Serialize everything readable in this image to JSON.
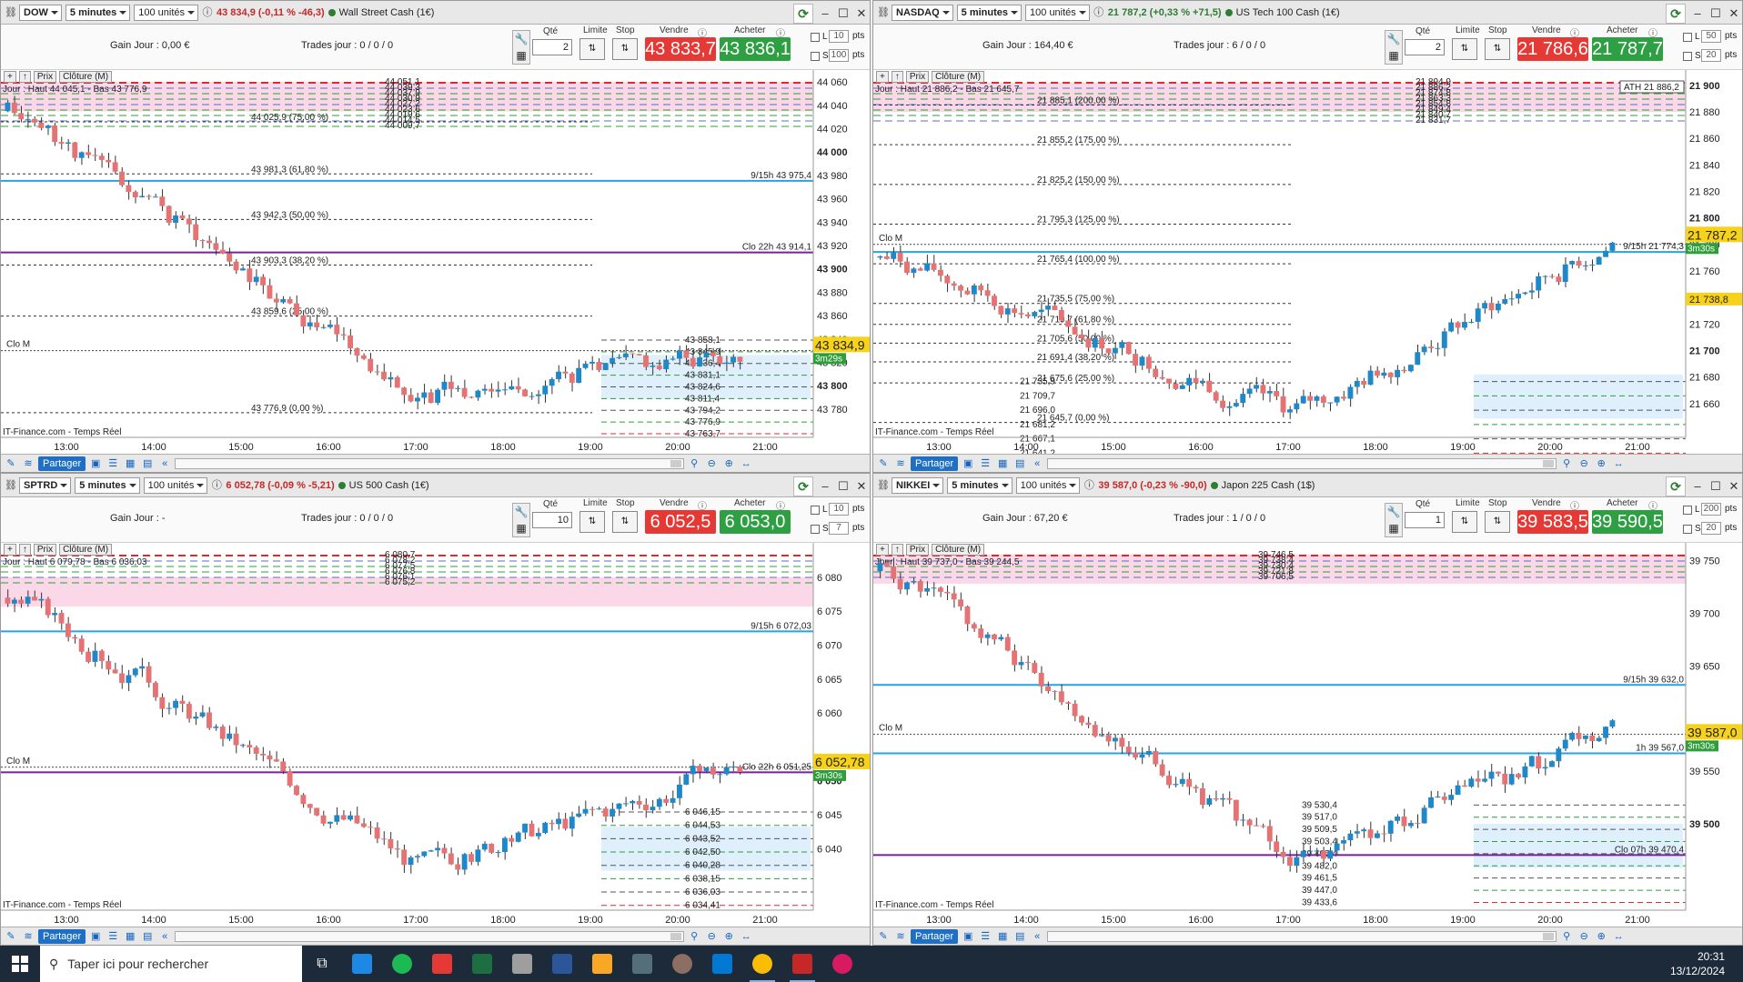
{
  "panes": [
    {
      "symbol": "DOW",
      "timeframe": "5 minutes",
      "units": "100 unités",
      "quote": "43 834,9 (-0,11 % -46,3)",
      "quote_class": "neg",
      "name": "Wall Street Cash (1€)",
      "gain": "Gain Jour : 0,00 €",
      "trades": "Trades jour : 0 / 0 / 0",
      "qty": "2",
      "sell": "43 833,7",
      "buy": "43 836,1",
      "pts1": "10",
      "pts2": "100",
      "chart": {
        "ymin": 43762,
        "ymax": 44064,
        "ticks": [
          {
            "v": 44060,
            "label": "44 060",
            "bold": false
          },
          {
            "v": 44040,
            "label": "44 040",
            "bold": false
          },
          {
            "v": 44020,
            "label": "44 020",
            "bold": false
          },
          {
            "v": 44000,
            "label": "44 000",
            "bold": true
          },
          {
            "v": 43980,
            "label": "43 980",
            "bold": false
          },
          {
            "v": 43960,
            "label": "43 960",
            "bold": false
          },
          {
            "v": 43940,
            "label": "43 940",
            "bold": false
          },
          {
            "v": 43920,
            "label": "43 920",
            "bold": false
          },
          {
            "v": 43900,
            "label": "43 900",
            "bold": true
          },
          {
            "v": 43880,
            "label": "43 880",
            "bold": false
          },
          {
            "v": 43860,
            "label": "43 860",
            "bold": false
          },
          {
            "v": 43840,
            "label": "43 840",
            "bold": false
          },
          {
            "v": 43820,
            "label": "43 820",
            "bold": false
          },
          {
            "v": 43800,
            "label": "43 800",
            "bold": true
          },
          {
            "v": 43780,
            "label": "43 780",
            "bold": false
          }
        ],
        "xlabels": [
          "13:00",
          "14:00",
          "15:00",
          "16:00",
          "17:00",
          "18:00",
          "19:00",
          "20:00",
          "21:00"
        ],
        "price_label": "43 834,9",
        "price_value": 43834.9,
        "timer": "3m29s",
        "day_label": "Jour : Haut 44 045,1 - Bas 43 776,9",
        "fibs": [
          {
            "v": 44025.9,
            "label": "44 025,9 (75,00 %)"
          },
          {
            "v": 43981.3,
            "label": "43 981,3 (61,80 %)"
          },
          {
            "v": 43942.3,
            "label": "43 942,3 (50,00 %)"
          },
          {
            "v": 43903.3,
            "label": "43 903,3 (38,20 %)"
          },
          {
            "v": 43859.6,
            "label": "43 859,6 (25,00 %)"
          },
          {
            "v": 43776.9,
            "label": "43 776,9 (0,00 %)"
          }
        ],
        "levels_top": [
          "44 051,1",
          "44 039,3",
          "44 037,9",
          "44 030,9",
          "44 027,2",
          "44 023,6",
          "44 019,6",
          "44 014,5",
          "44 009,7"
        ],
        "levels_bottom": [
          "43 858,1",
          "43 845,9",
          "43 836,4",
          "43 831,1",
          "43 824,6",
          "43 811,4",
          "43 794,2",
          "43 776,9",
          "43 763,7"
        ],
        "line_blue": {
          "v": 43975.4,
          "label": "9/15h 43 975,4"
        },
        "line_purple": {
          "v": 43914.1,
          "label": "Clo 22h 43 914,1"
        },
        "clo_m": {
          "v": 43830,
          "label": "Clo M"
        },
        "candles_seed": 11,
        "start": 44035,
        "low": 43790,
        "end": 43834.9,
        "footer_src": "IT-Finance.com - Temps Réel"
      }
    },
    {
      "symbol": "NASDAQ",
      "timeframe": "5 minutes",
      "units": "100 unités",
      "quote": "21 787,2 (+0,33 % +71,5)",
      "quote_class": "pos",
      "name": "US Tech 100 Cash (1€)",
      "gain": "Gain Jour : 164,40 €",
      "trades": "Trades jour : 6 / 0 / 0",
      "qty": "2",
      "sell": "21 786,6",
      "buy": "21 787,7",
      "pts1": "50",
      "pts2": "20",
      "chart": {
        "ymin": 21640,
        "ymax": 21906,
        "ticks": [
          {
            "v": 21900,
            "label": "21 900",
            "bold": true
          },
          {
            "v": 21880,
            "label": "21 880",
            "bold": false
          },
          {
            "v": 21860,
            "label": "21 860",
            "bold": false
          },
          {
            "v": 21840,
            "label": "21 840",
            "bold": false
          },
          {
            "v": 21820,
            "label": "21 820",
            "bold": false
          },
          {
            "v": 21800,
            "label": "21 800",
            "bold": true
          },
          {
            "v": 21780,
            "label": "21 780",
            "bold": false
          },
          {
            "v": 21760,
            "label": "21 760",
            "bold": false
          },
          {
            "v": 21740,
            "label": "21 740",
            "bold": false
          },
          {
            "v": 21720,
            "label": "21 720",
            "bold": false
          },
          {
            "v": 21700,
            "label": "21 700",
            "bold": true
          },
          {
            "v": 21680,
            "label": "21 680",
            "bold": false
          },
          {
            "v": 21660,
            "label": "21 660",
            "bold": false
          }
        ],
        "xlabels": [
          "13:00",
          "14:00",
          "15:00",
          "16:00",
          "17:00",
          "18:00",
          "19:00",
          "20:00",
          "21:00"
        ],
        "price_label": "21 787,2",
        "price_value": 21787.2,
        "timer": "3m30s",
        "day_label": "Jour : Haut 21 886,2 - Bas 21 645,7",
        "fibs": [
          {
            "v": 21885.1,
            "label": "21 885,1 (200,00 %)"
          },
          {
            "v": 21855.2,
            "label": "21 855,2 (175,00 %)"
          },
          {
            "v": 21825.2,
            "label": "21 825,2 (150,00 %)"
          },
          {
            "v": 21795.3,
            "label": "21 795,3 (125,00 %)"
          },
          {
            "v": 21765.4,
            "label": "21 765,4 (100,00 %)"
          },
          {
            "v": 21735.5,
            "label": "21 735,5 (75,00 %)"
          },
          {
            "v": 21719.7,
            "label": "21 719,7 (61,80 %)"
          },
          {
            "v": 21705.6,
            "label": "21 705,6 (50,00 %)"
          },
          {
            "v": 21691.4,
            "label": "21 691,4 (38,20 %)"
          },
          {
            "v": 21675.6,
            "label": "21 675,6 (25,00 %)"
          },
          {
            "v": 21645.7,
            "label": "21 645,7 (0,00 %)"
          }
        ],
        "levels_top": [
          "21 894,9",
          "21 886,2",
          "21 874,8",
          "21 863,3",
          "21 854,8",
          "21 849,4",
          "21 840,7",
          "21 831,7"
        ],
        "levels_bottom": [
          "21 735,9",
          "21 709,7",
          "21 696,0",
          "21 681,2",
          "21 667,1",
          "21 641,2"
        ],
        "line_blue": {
          "v": 21774.3,
          "label": "9/15h 21 774,3"
        },
        "line_purple": null,
        "ath_label": "ATH 21 886,2",
        "right_tag": "21 738,8",
        "clo_m": {
          "v": 21780,
          "label": "Clo M"
        },
        "candles_seed": 7,
        "start": 21770,
        "low": 21650,
        "end": 21787.2,
        "footer_src": "IT-Finance.com - Temps Réel"
      }
    },
    {
      "symbol": "SPTRD",
      "timeframe": "5 minutes",
      "units": "100 unités",
      "quote": "6 052,78 (-0,09 % -5,21)",
      "quote_class": "neg",
      "name": "US 500 Cash (1€)",
      "gain": "Gain Jour : -",
      "trades": "Trades jour : 0 / 0 / 0",
      "qty": "10",
      "sell": "6 052,5",
      "buy": "6 053,0",
      "pts1": "10",
      "pts2": "7",
      "chart": {
        "ymin": 6032,
        "ymax": 6084,
        "ticks": [
          {
            "v": 6080,
            "label": "6 080",
            "bold": false
          },
          {
            "v": 6075,
            "label": "6 075",
            "bold": false
          },
          {
            "v": 6070,
            "label": "6 070",
            "bold": false
          },
          {
            "v": 6065,
            "label": "6 065",
            "bold": false
          },
          {
            "v": 6060,
            "label": "6 060",
            "bold": false
          },
          {
            "v": 6050,
            "label": "6 050",
            "bold": true
          },
          {
            "v": 6045,
            "label": "6 045",
            "bold": false
          },
          {
            "v": 6040,
            "label": "6 040",
            "bold": false
          }
        ],
        "xlabels": [
          "13:00",
          "14:00",
          "15:00",
          "16:00",
          "17:00",
          "18:00",
          "19:00",
          "20:00",
          "21:00"
        ],
        "price_label": "6 052,78",
        "price_value": 6052.78,
        "timer": "3m30s",
        "day_label": "Jour : Haut 6 079,78 - Bas 6 036,03",
        "fibs": [],
        "levels_top": [
          "6 080,7",
          "6 078,2",
          "6 077,5",
          "6 076,8",
          "6 076,1",
          "6 075,2"
        ],
        "levels_bottom": [
          "6 046,15",
          "6 044,53",
          "6 043,52",
          "6 042,50",
          "6 040,28",
          "6 038,15",
          "6 036,03",
          "6 034,41"
        ],
        "line_blue": {
          "v": 6072.03,
          "label": "9/15h 6 072,03"
        },
        "line_purple": {
          "v": 6051.25,
          "label": "Clo 22h 6 051,25"
        },
        "clo_m": {
          "v": 6052,
          "label": "Clo M"
        },
        "candles_seed": 3,
        "start": 6077,
        "low": 6037,
        "end": 6052.78,
        "footer_src": "IT-Finance.com - Temps Réel"
      }
    },
    {
      "symbol": "NIKKEI",
      "timeframe": "5 minutes",
      "units": "100 unités",
      "quote": "39 587,0 (-0,23 % -90,0)",
      "quote_class": "neg",
      "name": "Japon 225 Cash (1$)",
      "gain": "Gain Jour : 67,20 €",
      "trades": "Trades jour : 1 / 0 / 0",
      "qty": "1",
      "sell": "39 583,5",
      "buy": "39 590,5",
      "pts1": "200",
      "pts2": "20",
      "chart": {
        "ymin": 39425,
        "ymax": 39760,
        "ticks": [
          {
            "v": 39750,
            "label": "39 750",
            "bold": false
          },
          {
            "v": 39700,
            "label": "39 700",
            "bold": false
          },
          {
            "v": 39650,
            "label": "39 650",
            "bold": false
          },
          {
            "v": 39550,
            "label": "39 550",
            "bold": false
          },
          {
            "v": 39500,
            "label": "39 500",
            "bold": true
          }
        ],
        "xlabels": [
          "13:00",
          "14:00",
          "15:00",
          "16:00",
          "17:00",
          "18:00",
          "19:00",
          "20:00",
          "21:00"
        ],
        "price_label": "39 587,0",
        "price_value": 39587.0,
        "timer": "3m30s",
        "day_label": "Jour : Haut 39 737,0 - Bas 39 244,5",
        "fibs": [],
        "levels_top": [
          "39 746,5",
          "39 738,4",
          "39 730,4",
          "39 721,8",
          "39 706,5"
        ],
        "levels_bottom": [
          "39 530,4",
          "39 517,0",
          "39 509,5",
          "39 503,4",
          "39 495,4",
          "39 482,0",
          "39 461,5",
          "39 447,0",
          "39 433,6"
        ],
        "line_blue": {
          "v": 39632.0,
          "label": "9/15h 39 632,0"
        },
        "line_purple": {
          "v": 39470.4,
          "label": "Clo 07h 39 470,4"
        },
        "line_blue2": {
          "v": 39567.0,
          "label": "1h 39 567,0"
        },
        "clo_m": {
          "v": 39585,
          "label": "Clo M"
        },
        "candles_seed": 5,
        "start": 39740,
        "low": 39460,
        "end": 39587.0,
        "footer_src": "IT-Finance.com - Temps Réel"
      }
    }
  ],
  "labels": {
    "qte": "Qté",
    "limite": "Limite",
    "stop": "Stop",
    "vendre": "Vendre",
    "acheter": "Acheter",
    "prix": "Prix",
    "cloture": "Clôture (M)",
    "partager": "Partager",
    "pts": "pts",
    "L": "L",
    "S": "S"
  },
  "taskbar": {
    "search_placeholder": "Taper ici pour rechercher",
    "time": "20:31",
    "date": "13/12/2024"
  },
  "colors": {
    "up": "#1e88c8",
    "down": "#e57373",
    "blue_line": "#29a3e0",
    "purple_line": "#7b1fa2",
    "red_dash": "#d32f2f",
    "green_dash": "#2e9d3a",
    "zone_pink": "#f8c8de",
    "zone_blue": "#d7ecfb",
    "price_tag": "#f7d21a"
  }
}
